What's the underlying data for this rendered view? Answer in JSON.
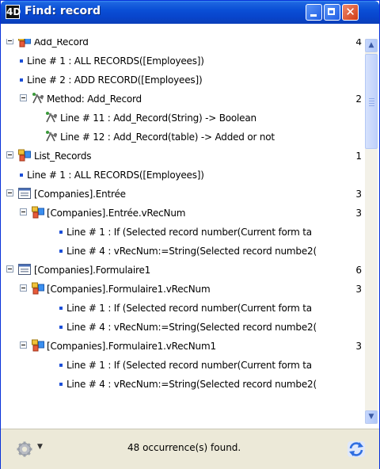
{
  "window": {
    "title": "Find: record",
    "app_icon_text": "4D"
  },
  "results": [
    {
      "kind": "method",
      "label": "Add_Record",
      "count": "4"
    },
    {
      "kind": "line",
      "label": "Line # 1 : ALL RECORDS([Employees])"
    },
    {
      "kind": "line",
      "label": "Line # 2 : ADD RECORD([Employees])"
    },
    {
      "kind": "method-declared",
      "label": "Method: Add_Record",
      "count": "2"
    },
    {
      "kind": "decl-line",
      "label": "Line # 11 : Add_Record(String) -> Boolean"
    },
    {
      "kind": "decl-line",
      "label": "Line # 12 : Add_Record(table) -> Added or not"
    },
    {
      "kind": "method",
      "label": "List_Records",
      "count": "1"
    },
    {
      "kind": "line",
      "label": "Line # 1 : ALL RECORDS([Employees])"
    },
    {
      "kind": "form",
      "label": "[Companies].Entrée",
      "count": "3"
    },
    {
      "kind": "object-method",
      "label": "[Companies].Entrée.vRecNum",
      "count": "3"
    },
    {
      "kind": "line",
      "label": "Line # 1 : If (Selected record number(Current form ta"
    },
    {
      "kind": "line",
      "label": "Line # 4 : vRecNum:=String(Selected record numbe2("
    },
    {
      "kind": "form",
      "label": "[Companies].Formulaire1",
      "count": "6"
    },
    {
      "kind": "object-method",
      "label": "[Companies].Formulaire1.vRecNum",
      "count": "3"
    },
    {
      "kind": "line",
      "label": "Line # 1 : If (Selected record number(Current form ta"
    },
    {
      "kind": "line",
      "label": "Line # 4 : vRecNum:=String(Selected record numbe2("
    },
    {
      "kind": "object-method",
      "label": "[Companies].Formulaire1.vRecNum1",
      "count": "3"
    },
    {
      "kind": "line",
      "label": "Line # 1 : If (Selected record number(Current form ta"
    },
    {
      "kind": "line",
      "label": "Line # 4 : vRecNum:=String(Selected record numbe2("
    }
  ],
  "status": {
    "text": "48 occurrence(s) found.",
    "options_icon": "gear-icon",
    "refresh_icon": "refresh-icon"
  },
  "colors": {
    "titlebar": "#0a4fd6",
    "bullet": "#1c4fd8",
    "statusbar": "#ece9d8"
  }
}
